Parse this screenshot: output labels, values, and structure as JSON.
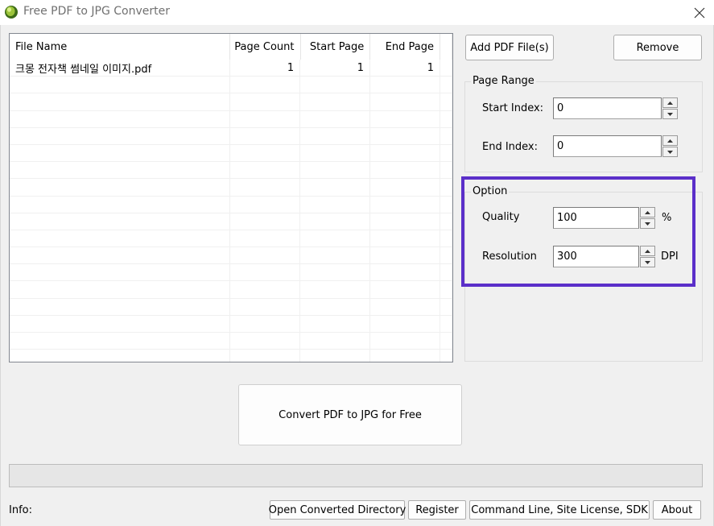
{
  "window": {
    "title": "Free PDF to JPG Converter",
    "app_icon": "green-globe-icon",
    "close_icon": "close-icon"
  },
  "file_list": {
    "columns": [
      "File Name",
      "Page Count",
      "Start Page",
      "End Page"
    ],
    "rows": [
      {
        "file_name": "크몽 전자책 썸네일 이미지.pdf",
        "page_count": "1",
        "start_page": "1",
        "end_page": "1"
      }
    ]
  },
  "buttons": {
    "add_pdf": "Add PDF File(s)",
    "remove": "Remove",
    "convert": "Convert PDF to JPG for Free",
    "open_dir": "Open Converted Directory",
    "register": "Register",
    "command_line": "Command Line, Site License, SDK",
    "about": "About"
  },
  "page_range": {
    "title": "Page Range",
    "start_label": "Start Index:",
    "start_value": "0",
    "end_label": "End Index:",
    "end_value": "0"
  },
  "option": {
    "title": "Option",
    "quality_label": "Quality",
    "quality_value": "100",
    "quality_unit": "%",
    "resolution_label": "Resolution",
    "resolution_value": "300",
    "resolution_unit": "DPI"
  },
  "status": {
    "info_label": "Info:",
    "progress": 0
  },
  "colors": {
    "highlight": "#5b2fc9",
    "background": "#f0f0f0"
  }
}
